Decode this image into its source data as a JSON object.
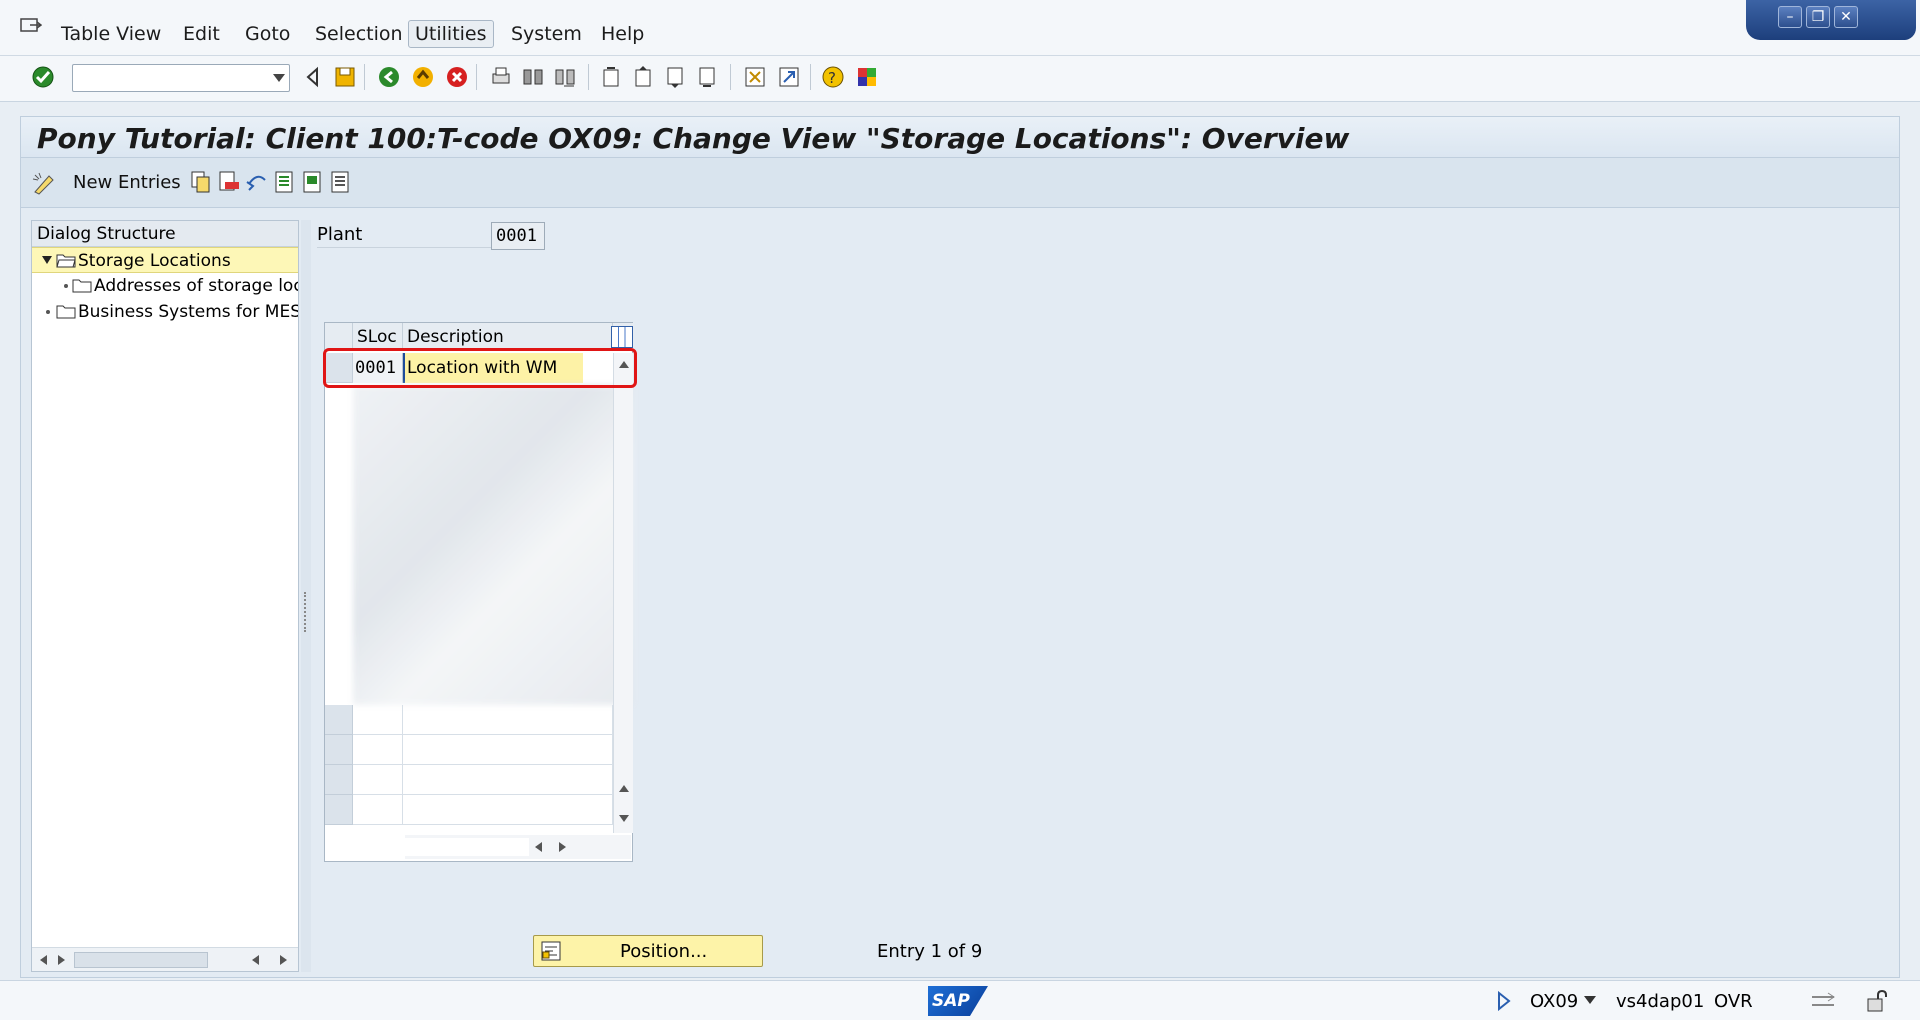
{
  "menu": {
    "items": [
      {
        "label": "Table View"
      },
      {
        "label": "Edit"
      },
      {
        "label": "Goto"
      },
      {
        "label": "Selection"
      },
      {
        "label": "Utilities"
      },
      {
        "label": "System"
      },
      {
        "label": "Help"
      }
    ],
    "active": "Utilities"
  },
  "toolbar": {
    "command_value": "",
    "icons": [
      "enter-icon",
      "back-icon",
      "save-icon",
      "exit-icon",
      "cancel-icon",
      "print-icon",
      "find-icon",
      "find-next-icon",
      "first-page-icon",
      "previous-page-icon",
      "next-page-icon",
      "last-page-icon",
      "create-session-icon",
      "shortcut-icon",
      "help-icon",
      "layout-icon"
    ]
  },
  "title": "Pony Tutorial: Client 100:T-code OX09: Change View \"Storage Locations\": Overview",
  "app_toolbar": {
    "new_entries_label": "New Entries"
  },
  "dialog_structure": {
    "header": "Dialog Structure",
    "nodes": [
      {
        "label": "Storage Locations",
        "selected": true
      },
      {
        "label": "Addresses of storage loc"
      },
      {
        "label": "Business Systems for MES"
      }
    ]
  },
  "plant": {
    "label": "Plant",
    "value": "0001"
  },
  "table": {
    "columns": [
      "SLoc",
      "Description"
    ],
    "rows": [
      {
        "sloc": "0001",
        "description": "Location with WM"
      }
    ]
  },
  "footer": {
    "position_label": "Position...",
    "entry_info": "Entry 1 of 9"
  },
  "status": {
    "logo": "SAP",
    "tcode": "OX09",
    "server": "vs4dap01",
    "mode": "OVR"
  },
  "colors": {
    "accent": "#1e4c9a",
    "highlight_border": "#e01515",
    "input_yellow": "#fdf2a6"
  }
}
